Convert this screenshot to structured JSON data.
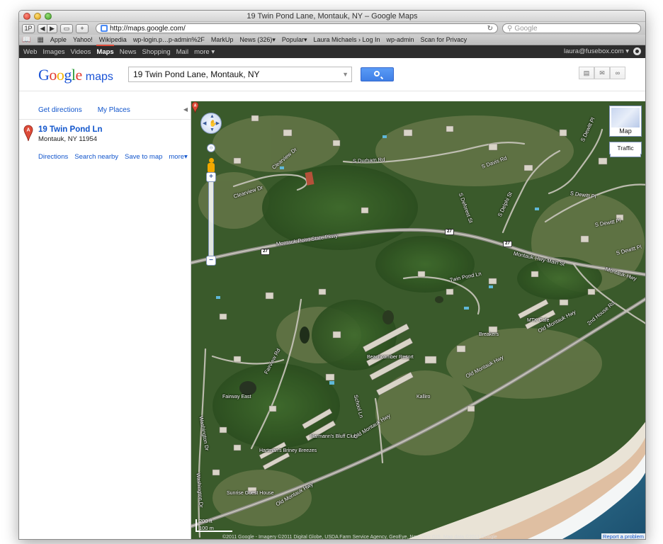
{
  "window": {
    "title": "19 Twin Pond Lane, Montauk, NY – Google Maps"
  },
  "browser": {
    "password_button": "1P",
    "back": "◀",
    "forward": "▶",
    "reading_list": "📖",
    "add_tab": "+",
    "url": "http://maps.google.com/",
    "reload": "↻",
    "search_placeholder": "Google",
    "bookmarks": [
      "Apple",
      "Yahoo!",
      "Wikipedia",
      "wp-login.p…p-admin%2F",
      "MarkUp",
      "News (326)▾",
      "Popular▾",
      "Laura Michaels › Log In",
      "wp-admin",
      "Scan for Privacy"
    ]
  },
  "google_bar": {
    "items": [
      "Web",
      "Images",
      "Videos",
      "Maps",
      "News",
      "Shopping",
      "Mail",
      "more ▾"
    ],
    "active": "Maps",
    "account": "laura@fusebox.com ▾"
  },
  "maps_header": {
    "logo_google": "Google",
    "logo_maps": "maps",
    "search_value": "19 Twin Pond Lane, Montauk, NY",
    "tool_icons": [
      "print-icon",
      "email-icon",
      "link-icon"
    ]
  },
  "panel": {
    "get_directions": "Get directions",
    "my_places": "My Places",
    "collapse": "◀",
    "result": {
      "marker": "A",
      "title": "19 Twin Pond Ln",
      "address": "Montauk, NY 11954"
    },
    "actions": [
      "Directions",
      "Search nearby",
      "Save to map",
      "more▾"
    ]
  },
  "map": {
    "map_type_label": "Map",
    "traffic_label": "Traffic",
    "zoom_in": "+",
    "zoom_out": "−",
    "scale_top": "200 ft",
    "scale_bottom": "100 m",
    "attribution": "©2011 Google - Imagery ©2011 Digital Globe, USDA Farm Service Agency, GeoEye, New York GIS, Map data ©2011 Google",
    "report": "Report a problem",
    "route_number": "27",
    "road_labels": [
      "S Durham Rd",
      "S Davis Rd",
      "S Dewitt Pl",
      "Clearview Dr",
      "Montauk Point State Pkwy",
      "Montauk-Hwy-Main St",
      "Twin Pond Ln",
      "Fairview Rd",
      "Old Montauk Hwy",
      "Old Montauk Hwy",
      "Old Montauk Hwy",
      "Old Montauk Hwy",
      "S Deforest St",
      "S Delphi St",
      "S Dewitt Pl",
      "S Dewitt Pl",
      "Washington Dr",
      "S Dewitt Pl",
      "2nd House Rd",
      "Montauk-Hwy",
      "School Ln",
      "Clearview Dr",
      "Washington Dr"
    ],
    "poi_labels": [
      "Beachcomber Resort",
      "Breakers",
      "MTK Cafe",
      "Kalliro",
      "Fairway East",
      "Harmann's Bluff Club",
      "Hartman's Briney Breezes",
      "Sunrise Guest House"
    ]
  },
  "colors": {
    "gbar_bg": "#2d2d2d",
    "link": "#1155cc",
    "search_button": "#4d90fe",
    "marker": "#dd4b39"
  }
}
